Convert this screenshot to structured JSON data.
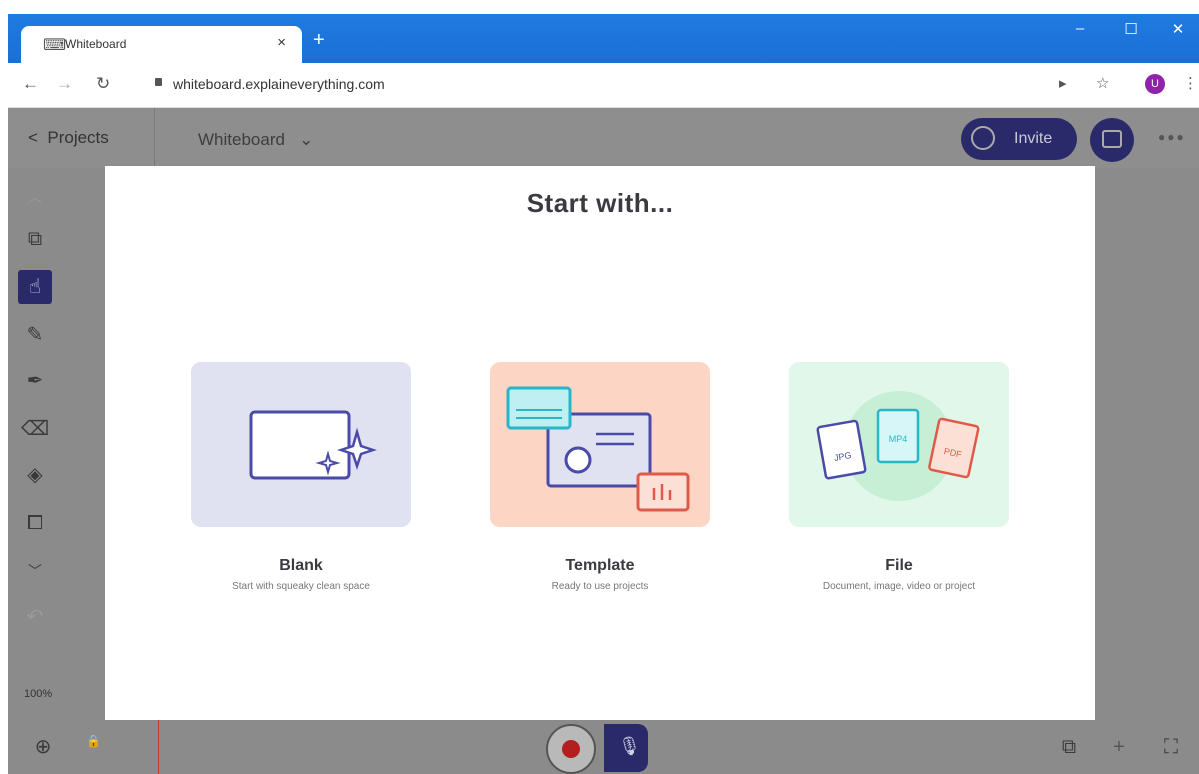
{
  "browser": {
    "tab_title": "Whiteboard",
    "tab_close": "×",
    "new_tab": "+",
    "url": "whiteboard.explaineverything.com",
    "avatar_letter": "U",
    "window_controls": {
      "minimize": "–",
      "maximize": "☐",
      "close": "✕"
    }
  },
  "app": {
    "back_label": "Projects",
    "board_name": "Whiteboard",
    "invite_label": "Invite",
    "zoom_level": "100%"
  },
  "modal": {
    "title": "Start with...",
    "options": [
      {
        "title": "Blank",
        "subtitle": "Start with squeaky clean space",
        "color": "#e0e1f1"
      },
      {
        "title": "Template",
        "subtitle": "Ready to use projects",
        "color": "#fcd5c4"
      },
      {
        "title": "File",
        "subtitle": "Document, image, video or project",
        "color": "#e0f7ea"
      }
    ],
    "file_types": [
      "JPG",
      "MP4",
      "PDF"
    ]
  },
  "colors": {
    "accent": "#2a2a6a",
    "chrome_blue": "#1b6fd6",
    "blank_stroke": "#4a4aa8",
    "template_stroke": "#e05a4a",
    "teal": "#28b7c8"
  }
}
